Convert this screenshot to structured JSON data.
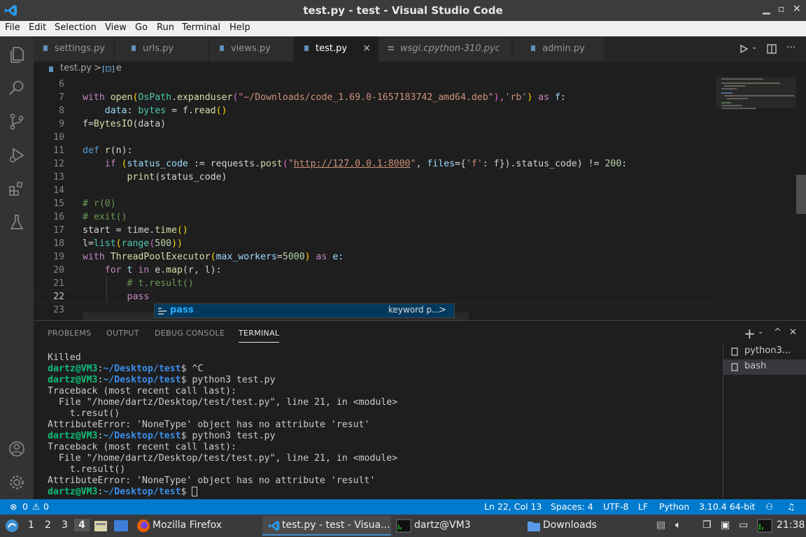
{
  "window": {
    "title": "test.py - test - Visual Studio Code"
  },
  "menu": [
    "File",
    "Edit",
    "Selection",
    "View",
    "Go",
    "Run",
    "Terminal",
    "Help"
  ],
  "tabs": [
    {
      "label": "settings.py"
    },
    {
      "label": "urls.py"
    },
    {
      "label": "views.py"
    },
    {
      "label": "test.py",
      "active": true,
      "close": "×"
    },
    {
      "label": "wsgi.cpython-310.pyc"
    },
    {
      "label": "admin.py"
    }
  ],
  "breadcrumb": {
    "file": "test.py",
    "sep": ">",
    "symbol": "e"
  },
  "editor": {
    "line_numbers": [
      "6",
      "7",
      "8",
      "9",
      "10",
      "11",
      "12",
      "13",
      "14",
      "15",
      "16",
      "17",
      "18",
      "19",
      "20",
      "21",
      "22",
      "23"
    ],
    "current_line": "22",
    "lines": {
      "l7": {
        "p1": "with ",
        "p2": "open",
        "p3": "(",
        "p4": "OsPath",
        "p5": ".",
        "p6": "expanduser",
        "p7": "(",
        "p8": "\"~/Downloads/code_1.69.0-1657183742_amd64.deb\"",
        "p9": "),",
        "p10": "'rb'",
        "p11": ") ",
        "p12": "as",
        "p13": " f:"
      },
      "l8": {
        "p1": "    data",
        "p2": ": ",
        "p3": "bytes",
        "p4": " = f.",
        "p5": "read",
        "p6": "()"
      },
      "l9": {
        "p1": "f=",
        "p2": "BytesIO",
        "p3": "(data)"
      },
      "l11": {
        "p1": "def ",
        "p2": "r",
        "p3": "(n):"
      },
      "l12": {
        "p1": "    if ",
        "p2": "(",
        "p3": "status_code",
        "p4": " := requests.",
        "p5": "post",
        "p6": "(",
        "p7": "\"",
        "p8": "http://127.0.0.1:8000",
        "p9": "\"",
        "p10": ", ",
        "p11": "files",
        "p12": "={",
        "p13": "'f'",
        "p14": ": f}).status_code) != ",
        "p15": "200",
        "p16": ":"
      },
      "l13": {
        "p1": "        ",
        "p2": "print",
        "p3": "(status_code)"
      },
      "l15": {
        "p1": "# r(0)"
      },
      "l16": {
        "p1": "# exit()"
      },
      "l17": {
        "p1": "start = time.",
        "p2": "time",
        "p3": "()"
      },
      "l18": {
        "p1": "l=",
        "p2": "list",
        "p3": "(",
        "p4": "range",
        "p5": "(",
        "p6": "500",
        "p7": "))"
      },
      "l19": {
        "p1": "with ",
        "p2": "ThreadPoolExecutor",
        "p3": "(",
        "p4": "max_workers",
        "p5": "=",
        "p6": "5000",
        "p7": ") ",
        "p8": "as",
        "p9": " e:"
      },
      "l20": {
        "p1": "    for ",
        "p2": "t ",
        "p3": "in",
        "p4": " e.",
        "p5": "map",
        "p6": "(r, l):"
      },
      "l21": {
        "p1": "        # t.result()"
      },
      "l22": {
        "p1": "        pass"
      }
    }
  },
  "suggest": {
    "label": "pass",
    "detail": "keyword p...",
    "more": ">"
  },
  "panel": {
    "tabs": [
      "PROBLEMS",
      "OUTPUT",
      "DEBUG CONSOLE",
      "TERMINAL"
    ],
    "active_tab": "TERMINAL",
    "plus": "+",
    "terminals": [
      "python3...",
      "bash"
    ]
  },
  "terminal": {
    "killed": "Killed",
    "user": "dartz@VM3",
    "colon": ":",
    "path": "~/Desktop/test",
    "dollar": "$ ",
    "cmd_ctrl_c": "^C",
    "cmd_run": "python3 test.py",
    "tb_header": "Traceback (most recent call last):",
    "tb_file": "  File \"/home/dartz/Desktop/test/test.py\", line 21, in <module>",
    "tb_code1": "    t.resut()",
    "tb_err1": "AttributeError: 'NoneType' object has no attribute 'resut'",
    "tb_code2": "    t.result()",
    "tb_err2": "AttributeError: 'NoneType' object has no attribute 'result'"
  },
  "status": {
    "errors": "0",
    "warnings": "0",
    "position": "Ln 22, Col 13",
    "spaces": "Spaces: 4",
    "encoding": "UTF-8",
    "eol": "LF",
    "language": "Python",
    "interpreter": "3.10.4 64-bit"
  },
  "taskbar": {
    "workspaces": [
      "1",
      "2",
      "3",
      "4"
    ],
    "active_workspace": "4",
    "apps": [
      "Mozilla Firefox",
      "test.py - test - Visua...",
      "dartz@VM3",
      "Downloads"
    ],
    "clock": "21:38"
  },
  "colors": {
    "accent": "#007acc",
    "title_bg": "#3c3c3c",
    "editor_bg": "#1e1e1e"
  }
}
